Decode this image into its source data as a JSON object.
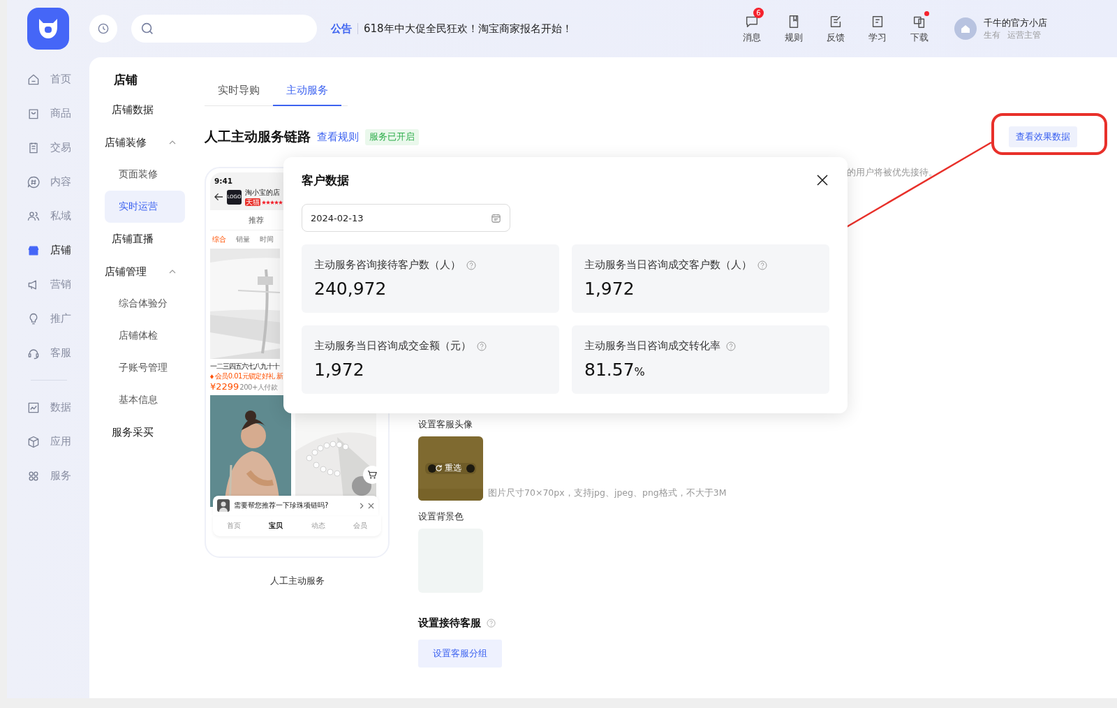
{
  "header": {
    "announcement": {
      "label": "公告",
      "text": "618年中大促全民狂欢！淘宝商家报名开始！"
    },
    "tools": [
      {
        "label": "消息",
        "badge": "6",
        "dot": false
      },
      {
        "label": "规则",
        "dot": false
      },
      {
        "label": "反馈",
        "dot": false
      },
      {
        "label": "学习",
        "dot": false
      },
      {
        "label": "下载",
        "dot": true
      }
    ],
    "account": {
      "name": "千牛的官方小店",
      "subtitle": "生有",
      "role": "运营主管"
    }
  },
  "rail": {
    "groups": [
      [
        {
          "label": "首页",
          "selected": false
        },
        {
          "label": "商品",
          "selected": false
        },
        {
          "label": "交易",
          "selected": false
        },
        {
          "label": "内容",
          "selected": false
        },
        {
          "label": "私域",
          "selected": false
        },
        {
          "label": "店铺",
          "selected": true
        },
        {
          "label": "营销",
          "selected": false
        },
        {
          "label": "推广",
          "selected": false
        },
        {
          "label": "客服",
          "selected": false
        }
      ],
      [
        {
          "label": "数据",
          "selected": false
        },
        {
          "label": "应用",
          "selected": false
        },
        {
          "label": "服务",
          "selected": false
        }
      ]
    ]
  },
  "subnav": {
    "title": "店铺",
    "items": [
      {
        "kind": "link",
        "label": "店铺数据",
        "selected": false
      },
      {
        "kind": "group",
        "label": "店铺装修",
        "expanded": true,
        "children": [
          {
            "label": "页面装修",
            "selected": false
          },
          {
            "label": "实时运营",
            "selected": true
          }
        ]
      },
      {
        "kind": "link",
        "label": "店铺直播",
        "selected": false
      },
      {
        "kind": "group",
        "label": "店铺管理",
        "expanded": true,
        "children": [
          {
            "label": "综合体验分",
            "selected": false
          },
          {
            "label": "店铺体检",
            "selected": false
          },
          {
            "label": "子账号管理",
            "selected": false
          },
          {
            "label": "基本信息",
            "selected": false
          }
        ]
      },
      {
        "kind": "link",
        "label": "服务采买",
        "selected": false
      }
    ]
  },
  "tabs": [
    {
      "label": "实时导购",
      "selected": false
    },
    {
      "label": "主动服务",
      "selected": true
    }
  ],
  "section": {
    "title": "人工主动服务链路",
    "rules_link": "查看规则",
    "status": "服务已开启",
    "effect_button": "查看效果数据",
    "note": "的用户将被优先接待。"
  },
  "preview": {
    "caption": "人工主动服务",
    "phone": {
      "time": "9:41",
      "logo": "LOGO",
      "shop": "淘小宝的店",
      "badge": "天猫",
      "stars": 5,
      "tabs": [
        {
          "label": "推荐",
          "selected": false
        }
      ],
      "sorts": [
        {
          "label": "综合",
          "selected": true
        },
        {
          "label": "销量",
          "selected": false
        },
        {
          "label": "时间",
          "selected": false
        }
      ],
      "product": {
        "title": "一二三四五六七八九十十",
        "promo": "会员0.01元锁定好礼 新",
        "price": "¥2299",
        "sales": "200+人付款"
      },
      "chat": "需要帮您推荐一下珍珠项链吗?",
      "nav": [
        {
          "label": "首页",
          "selected": false
        },
        {
          "label": "宝贝",
          "selected": true
        },
        {
          "label": "动态",
          "selected": false
        },
        {
          "label": "会员",
          "selected": false
        }
      ]
    }
  },
  "settings": {
    "avatar": {
      "label": "设置客服头像",
      "action": "重选",
      "hint": "图片尺寸70×70px，支持jpg、jpeg、png格式，不大于3M"
    },
    "background": {
      "label": "设置背景色",
      "color": "#f1f5f4"
    },
    "reception": {
      "label": "设置接待客服",
      "button": "设置客服分组"
    }
  },
  "dialog": {
    "title": "客户数据",
    "date": "2024-02-13",
    "metrics": [
      {
        "label": "主动服务咨询接待客户数（人）",
        "value": "240,972"
      },
      {
        "label": "主动服务当日咨询成交客户数（人）",
        "value": "1,972"
      },
      {
        "label": "主动服务当日咨询成交金额（元）",
        "value": "1,972"
      },
      {
        "label": "主动服务当日咨询成交转化率",
        "value": "81.57",
        "unit": "%"
      }
    ]
  }
}
